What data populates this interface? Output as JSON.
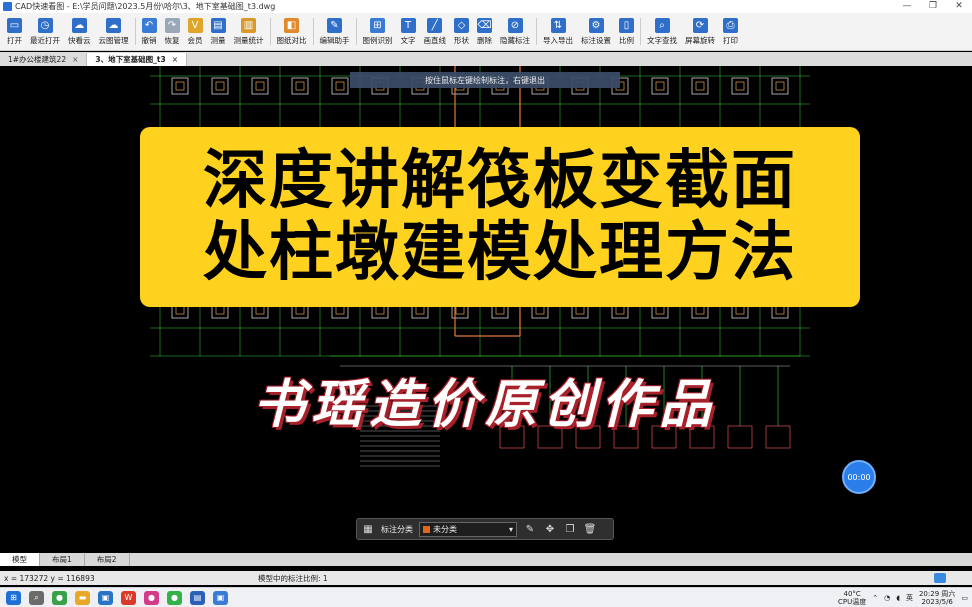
{
  "window": {
    "title": "CAD快速看图 - E:\\学员问题\\2023.5月份\\哈尔\\3、地下室基础图_t3.dwg",
    "controls": [
      "—",
      "❐",
      "✕"
    ]
  },
  "toolbar": [
    {
      "label": "打开",
      "icon": "folder-icon",
      "color": "#2f6fc9"
    },
    {
      "label": "最近打开",
      "icon": "clock-icon",
      "color": "#2f6fc9"
    },
    {
      "label": "快看云",
      "icon": "cloud-icon",
      "color": "#2f6fc9"
    },
    {
      "label": "云图管理",
      "icon": "cloud-manage-icon",
      "color": "#2f6fc9"
    },
    {
      "label": "撤销",
      "icon": "undo-icon",
      "color": "#3a7bd5"
    },
    {
      "label": "恢复",
      "icon": "redo-icon",
      "color": "#9aa7b8"
    },
    {
      "label": "会员",
      "icon": "vip-icon",
      "color": "#e0a52a"
    },
    {
      "label": "测量",
      "icon": "measure-icon",
      "color": "#2f6fc9"
    },
    {
      "label": "测量统计",
      "icon": "measure-stats-icon",
      "color": "#d99a2b"
    },
    {
      "label": "图纸对比",
      "icon": "compare-icon",
      "color": "#e08a2b"
    },
    {
      "label": "编辑助手",
      "icon": "edit-assistant-icon",
      "color": "#2f6fc9"
    },
    {
      "label": "图例识别",
      "icon": "legend-recognize-icon",
      "color": "#3a7bd5"
    },
    {
      "label": "文字",
      "icon": "text-icon",
      "color": "#2f6fc9"
    },
    {
      "label": "画直线",
      "icon": "line-icon",
      "color": "#2f6fc9"
    },
    {
      "label": "形状",
      "icon": "shape-icon",
      "color": "#2f6fc9"
    },
    {
      "label": "删除",
      "icon": "eraser-icon",
      "color": "#2f6fc9"
    },
    {
      "label": "隐藏标注",
      "icon": "hide-annotation-icon",
      "color": "#2f6fc9"
    },
    {
      "label": "导入导出",
      "icon": "import-export-icon",
      "color": "#2f6fc9"
    },
    {
      "label": "标注设置",
      "icon": "annotation-settings-icon",
      "color": "#2f6fc9"
    },
    {
      "label": "比例",
      "icon": "scale-icon",
      "color": "#2f6fc9"
    },
    {
      "label": "文字查找",
      "icon": "text-search-icon",
      "color": "#2f6fc9"
    },
    {
      "label": "屏幕旋转",
      "icon": "rotate-screen-icon",
      "color": "#2f6fc9"
    },
    {
      "label": "打印",
      "icon": "print-icon",
      "color": "#2f6fc9"
    }
  ],
  "doc_tabs": [
    {
      "label": "1#办公楼建筑22",
      "active": false
    },
    {
      "label": "3、地下室基础图_t3",
      "active": true
    }
  ],
  "hint": "按住鼠标左键绘制标注，右键退出",
  "overlay": {
    "banner_lines": [
      "深度讲解筏板变截面",
      "处柱墩建模处理方法"
    ],
    "author": "书瑶造价原创作品"
  },
  "timer": "00:00",
  "annotation_bar": {
    "label": "标注分类",
    "selected": "未分类",
    "selected_color": "#e0661c"
  },
  "layout_tabs": [
    "模型",
    "布局1",
    "布局2"
  ],
  "status": {
    "coords": "x = 173272  y = 116893",
    "scale": "模型中的标注比例: 1"
  },
  "tray": {
    "weather": "40°C",
    "weather_sub": "CPU温度",
    "lang": "英",
    "time": "20:29 周六",
    "date": "2023/5/6"
  }
}
